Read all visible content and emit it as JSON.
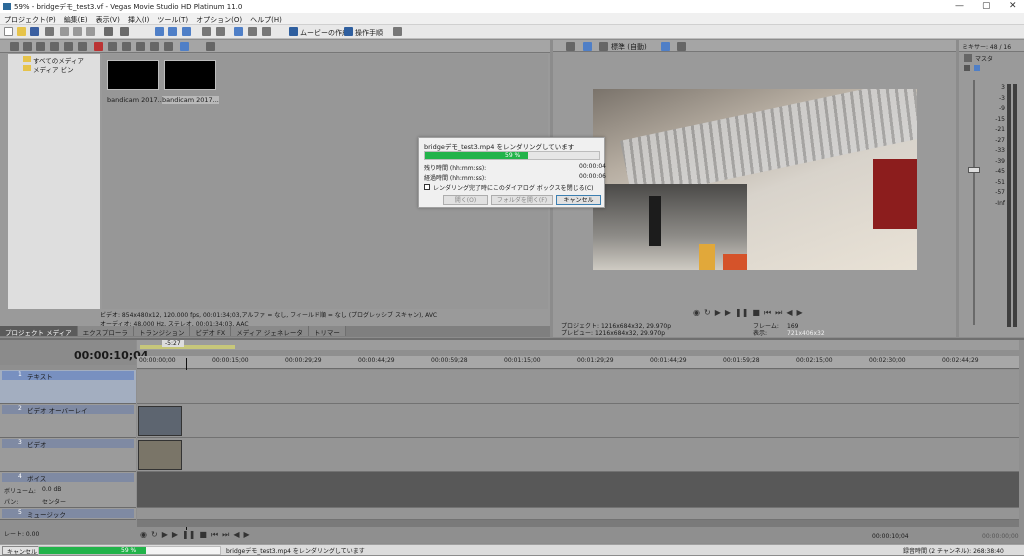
{
  "window": {
    "title": "59% - bridgeデモ_test3.vf - Vegas Movie Studio HD Platinum 11.0",
    "minimize": "—",
    "maximize": "▢",
    "close": "✕"
  },
  "menu": [
    "プロジェクト(P)",
    "編集(E)",
    "表示(V)",
    "挿入(I)",
    "ツール(T)",
    "オプション(O)",
    "ヘルプ(H)"
  ],
  "toolbar": {
    "make_movie": "ムービーの作成",
    "guide": "操作手順"
  },
  "media": {
    "tree": [
      "すべてのメディア",
      "メディア ビン"
    ],
    "items": [
      "bandicam 2017...",
      "bandicam 2017..."
    ],
    "info_line1": "ビデオ: 854x480x12, 120.000 fps, 00:01:34;03,アルファ = なし, フィールド順 = なし (プログレッシブ スキャン), AVC",
    "info_line2": "オーディオ: 48,000 Hz, ステレオ, 00:01:34;03, AAC",
    "tabs": [
      "プロジェクト メディア",
      "エクスプローラ",
      "トランジション",
      "ビデオ FX",
      "メディア ジェネレータ",
      "トリマー"
    ]
  },
  "preview": {
    "quality": "標準 (自動)",
    "project_label": "プロジェクト:",
    "project_value": "1216x684x32, 29.970p",
    "preview_label": "プレビュー:",
    "preview_value": "1216x684x32, 29.970p",
    "frame_label": "フレーム:",
    "frame_value": "169",
    "display_label": "表示:",
    "display_value": "721x406x32"
  },
  "mixer": {
    "title": "ミキサー: 48 / 16",
    "master": "マスタ",
    "scale": [
      "-Inf",
      "3",
      "-3",
      "-9",
      "-15",
      "-21",
      "-27",
      "-33",
      "-39",
      "-45",
      "-51",
      "-57",
      "-Inf"
    ]
  },
  "render_dialog": {
    "message": "bridgeデモ_test3.mp4 をレンダリングしています",
    "progress": 59,
    "progress_label": "59 %",
    "remaining_label": "残り時間 (hh:mm:ss):",
    "remaining_value": "00:00:04",
    "elapsed_label": "経過時間 (hh:mm:ss):",
    "elapsed_value": "00:00:06",
    "checkbox_label": "レンダリング完了時にこのダイアログ ボックスを閉じる(C)",
    "open_button": "開く(O)",
    "open_folder_button": "フォルダを開く(F)",
    "cancel_button": "キャンセル"
  },
  "timeline": {
    "timecode": "00:00:10;04",
    "region_label": "-5:27",
    "ruler": [
      "00:00:00;00",
      "00:00:15;00",
      "00:00:29;29",
      "00:00:44;29",
      "00:00:59;28",
      "00:01:15;00",
      "00:01:29;29",
      "00:01:44;29",
      "00:01:59;28",
      "00:02:15;00",
      "00:02:30;00",
      "00:02:44;29"
    ],
    "tracks": [
      {
        "num": "1",
        "name": "テキスト"
      },
      {
        "num": "2",
        "name": "ビデオ オーバーレイ"
      },
      {
        "num": "3",
        "name": "ビデオ"
      },
      {
        "num": "4",
        "name": "ボイス"
      },
      {
        "num": "5",
        "name": "ミュージック"
      }
    ],
    "volume_label": "ボリューム:",
    "volume_value": "0.0 dB",
    "pan_label": "パン:",
    "pan_value": "センター",
    "rate_label": "レート: 0.00",
    "transport_time": "00:00:10;04",
    "end_time": "00:00:00;00"
  },
  "statusbar": {
    "cancel": "キャンセル",
    "progress": 59,
    "progress_label": "59 %",
    "message": "bridgeデモ_test3.mp4 をレンダリングしています",
    "right": "録音時間 (2 チャンネル): 268:38:40"
  },
  "colors": {
    "accent_blue": "#5577bb",
    "progress_green": "#22b34a",
    "voice_track": "#585858"
  }
}
